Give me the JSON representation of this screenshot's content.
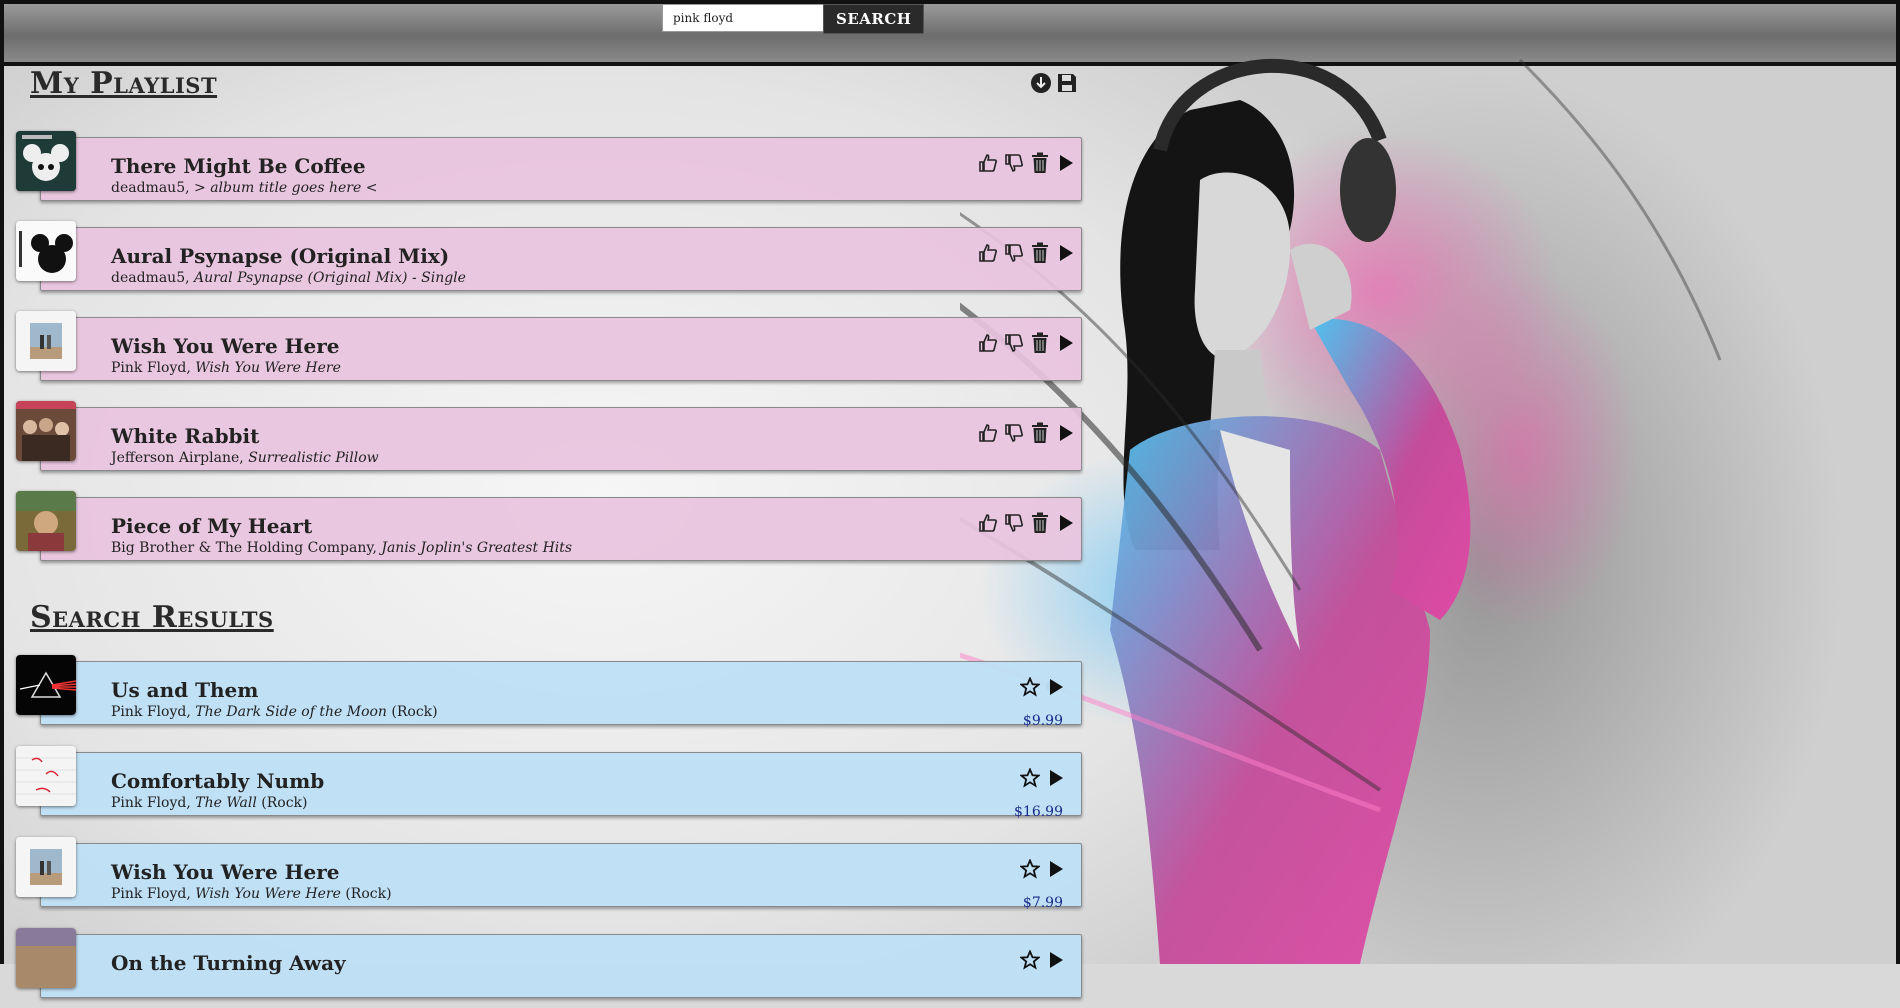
{
  "search": {
    "query": "pink floyd",
    "button_label": "SEARCH"
  },
  "playlist": {
    "title": "My Playlist",
    "items": [
      {
        "title": "There Might Be Coffee",
        "artist": "deadmau5",
        "album": "> album title goes here <"
      },
      {
        "title": "Aural Psynapse (Original Mix)",
        "artist": "deadmau5",
        "album": "Aural Psynapse (Original Mix) - Single"
      },
      {
        "title": "Wish You Were Here",
        "artist": "Pink Floyd",
        "album": "Wish You Were Here"
      },
      {
        "title": "White Rabbit",
        "artist": "Jefferson Airplane",
        "album": "Surrealistic Pillow"
      },
      {
        "title": "Piece of My Heart",
        "artist": "Big Brother & The Holding Company",
        "album": "Janis Joplin's Greatest Hits"
      }
    ]
  },
  "results": {
    "title": "Search Results",
    "items": [
      {
        "title": "Us and Them",
        "artist": "Pink Floyd",
        "album": "The Dark Side of the Moon",
        "genre": "(Rock)",
        "price": "$9.99"
      },
      {
        "title": "Comfortably Numb",
        "artist": "Pink Floyd",
        "album": "The Wall",
        "genre": "(Rock)",
        "price": "$16.99"
      },
      {
        "title": "Wish You Were Here",
        "artist": "Pink Floyd",
        "album": "Wish You Were Here",
        "genre": "(Rock)",
        "price": "$7.99"
      },
      {
        "title": "On the Turning Away",
        "artist": "",
        "album": "",
        "genre": "",
        "price": ""
      }
    ]
  },
  "icons": {
    "download": "download-icon",
    "save": "save-icon",
    "thumbs_up": "thumbs-up-icon",
    "thumbs_down": "thumbs-down-icon",
    "trash": "trash-icon",
    "play": "play-icon",
    "star": "star-icon"
  },
  "colors": {
    "playlist_card": "#e9c3de",
    "result_card": "#bedff6",
    "price": "#1a2a8a"
  }
}
